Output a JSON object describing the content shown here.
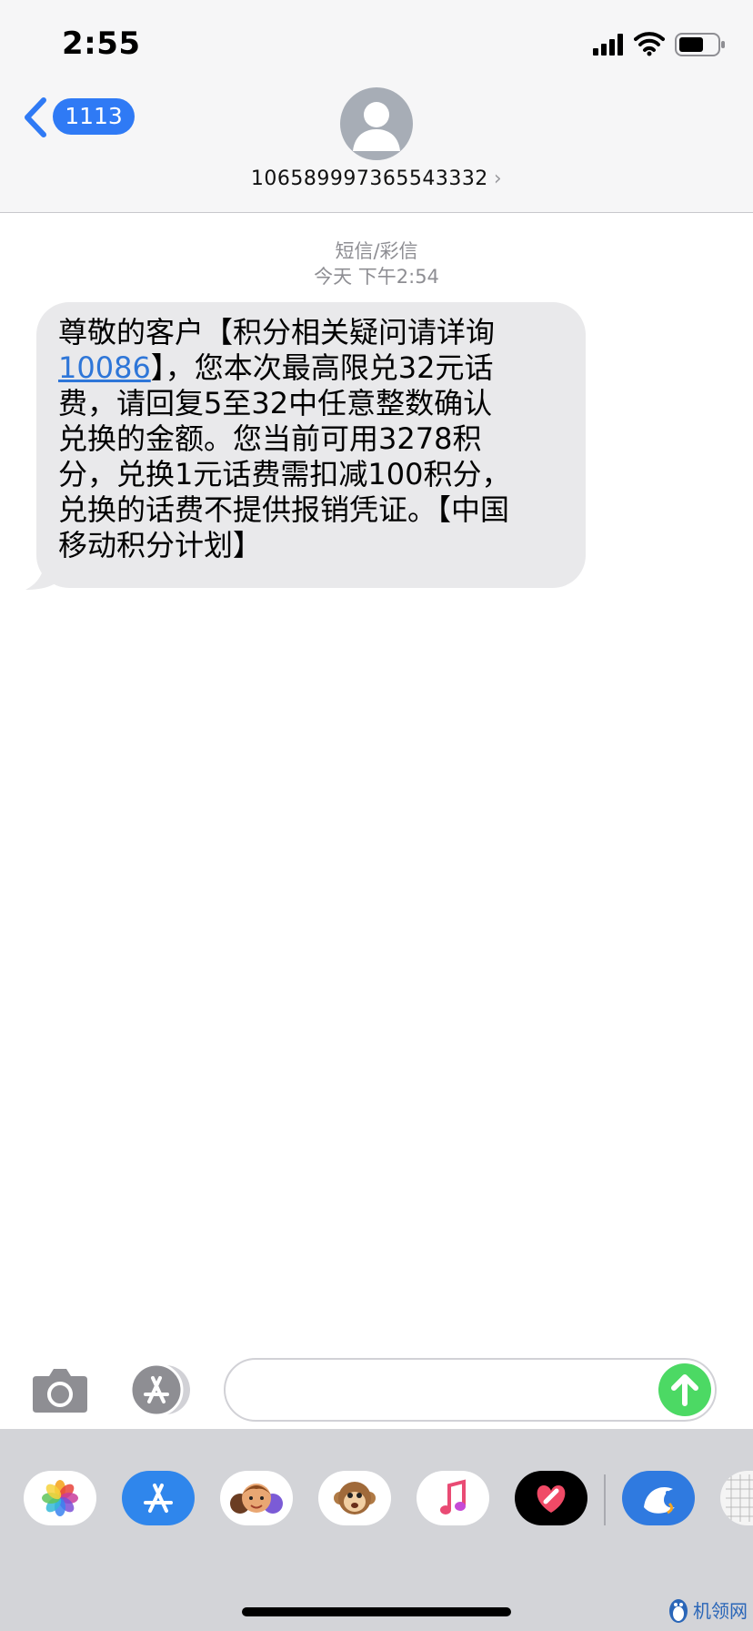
{
  "status_bar": {
    "time": "2:55"
  },
  "nav": {
    "back_badge": "1113",
    "contact_number": "106589997365543332",
    "chevron": "›"
  },
  "conversation": {
    "service_type": "短信/彩信",
    "timestamp": "今天 下午2:54",
    "message": {
      "line1": "尊敬的客户【积分相关疑问请详询",
      "link": "10086",
      "line2_rest": "】，您本次最高限兑32元话",
      "line3": "费，请回复5至32中任意整数确认",
      "line4": "兑换的金额。您当前可用3278积",
      "line5": "分，兑换1元话费需扣减100积分，",
      "line6": "兑换的话费不提供报销凭证。【中国",
      "line7": "移动积分计划】"
    }
  },
  "input_bar": {
    "message_value": ""
  },
  "app_drawer": {
    "apps": [
      "photos-icon",
      "app-store-icon",
      "memoji-icon",
      "animoji-monkey-icon",
      "music-icon",
      "digital-touch-icon",
      "ctrip-icon",
      "grid-app-icon"
    ]
  },
  "watermark": {
    "text": "机领网"
  },
  "colors": {
    "accent": "#2f7af5",
    "send": "#4cd964",
    "bubble": "#e9e9eb",
    "link": "#2e76d8",
    "drawer": "#d3d4d8"
  }
}
